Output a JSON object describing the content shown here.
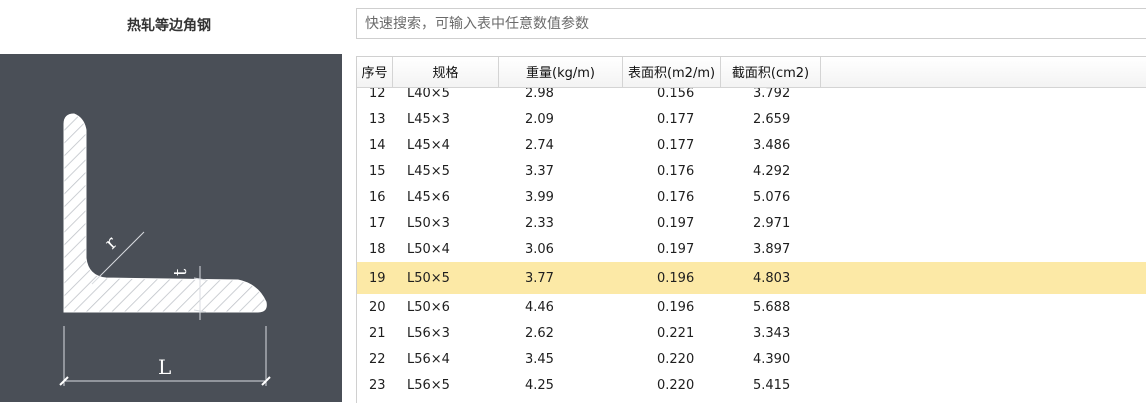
{
  "app": {
    "title": "热轧等边角钢"
  },
  "search": {
    "placeholder": "快速搜索，可输入表中任意数值参数",
    "value": ""
  },
  "diagram": {
    "label_r": "r",
    "label_t": "t",
    "label_L": "L"
  },
  "table": {
    "headers": [
      "序号",
      "规格",
      "重量(kg/m)",
      "表面积(m2/m)",
      "截面积(cm2)"
    ],
    "selected_index": 19,
    "rows": [
      [
        "12",
        "L40×5",
        "2.98",
        "0.156",
        "3.792"
      ],
      [
        "13",
        "L45×3",
        "2.09",
        "0.177",
        "2.659"
      ],
      [
        "14",
        "L45×4",
        "2.74",
        "0.177",
        "3.486"
      ],
      [
        "15",
        "L45×5",
        "3.37",
        "0.176",
        "4.292"
      ],
      [
        "16",
        "L45×6",
        "3.99",
        "0.176",
        "5.076"
      ],
      [
        "17",
        "L50×3",
        "2.33",
        "0.197",
        "2.971"
      ],
      [
        "18",
        "L50×4",
        "3.06",
        "0.197",
        "3.897"
      ],
      [
        "19",
        "L50×5",
        "3.77",
        "0.196",
        "4.803"
      ],
      [
        "20",
        "L50×6",
        "4.46",
        "0.196",
        "5.688"
      ],
      [
        "21",
        "L56×3",
        "2.62",
        "0.221",
        "3.343"
      ],
      [
        "22",
        "L56×4",
        "3.45",
        "0.220",
        "4.390"
      ],
      [
        "23",
        "L56×5",
        "4.25",
        "0.220",
        "5.415"
      ]
    ]
  }
}
